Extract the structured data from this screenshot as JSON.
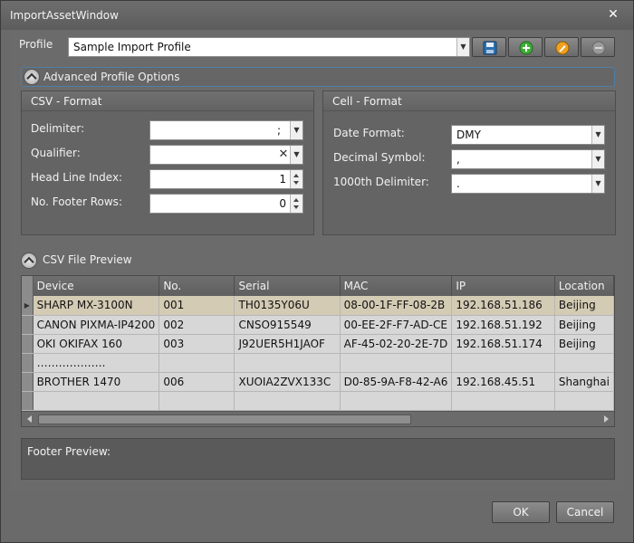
{
  "window": {
    "title": "ImportAssetWindow"
  },
  "profile": {
    "label": "Profile",
    "value": "Sample Import Profile"
  },
  "toolbar": {
    "icons": [
      "save-icon",
      "add-icon",
      "edit-icon",
      "remove-icon"
    ]
  },
  "advanced": {
    "label": "Advanced Profile Options"
  },
  "csv_format": {
    "title": "CSV - Format",
    "delimiter": {
      "label": "Delimiter:",
      "value": ";"
    },
    "qualifier": {
      "label": "Qualifier:",
      "value": ""
    },
    "head_line_index": {
      "label": "Head Line Index:",
      "value": "1"
    },
    "footer_rows": {
      "label": "No. Footer Rows:",
      "value": "0"
    }
  },
  "cell_format": {
    "title": "Cell - Format",
    "date_format": {
      "label": "Date Format:",
      "value": "DMY"
    },
    "decimal_symbol": {
      "label": "Decimal Symbol:",
      "value": ","
    },
    "thousand_delimiter": {
      "label": "1000th Delimiter:",
      "value": "."
    }
  },
  "preview": {
    "label": "CSV File Preview",
    "columns": [
      "Device",
      "No.",
      "Serial",
      "MAC",
      "IP",
      "Location"
    ],
    "rows": [
      [
        "SHARP MX-3100N",
        "001",
        "TH0135Y06U",
        "08-00-1F-FF-08-2B",
        "192.168.51.186",
        "Beijing"
      ],
      [
        "CANON PIXMA-IP4200",
        "002",
        "CNSO915549",
        "00-EE-2F-F7-AD-CE",
        "192.168.51.192",
        "Beijing"
      ],
      [
        "OKI OKIFAX 160",
        "003",
        "J92UER5H1JAOF",
        "AF-45-02-20-2E-7D",
        "192.168.51.174",
        "Beijing"
      ],
      [
        "……………….",
        "",
        "",
        "",
        "",
        ""
      ],
      [
        "BROTHER 1470",
        "006",
        "XUOIA2ZVX133C",
        "D0-85-9A-F8-42-A6",
        "192.168.45.51",
        "Shanghai"
      ],
      [
        "",
        "",
        "",
        "",
        "",
        ""
      ]
    ]
  },
  "footer_preview": {
    "label": "Footer Preview:"
  },
  "buttons": {
    "ok": "OK",
    "cancel": "Cancel"
  }
}
